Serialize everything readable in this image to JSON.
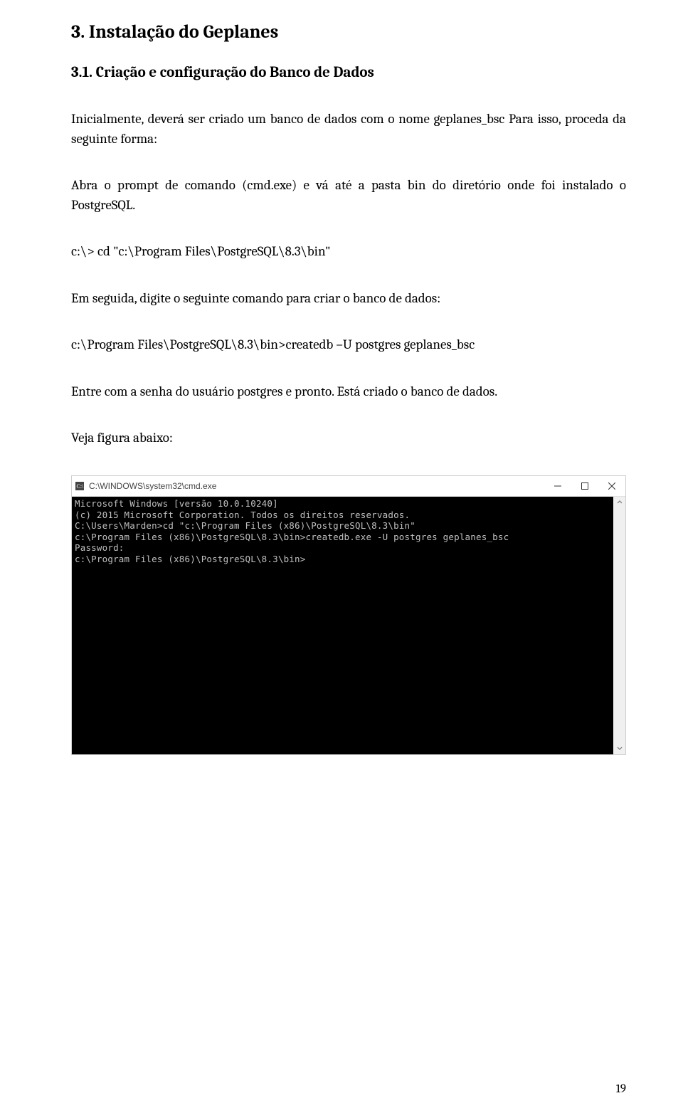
{
  "heading": "3. Instalação do Geplanes",
  "subheading": "3.1. Criação e configuração do Banco de Dados",
  "para1": "Inicialmente, deverá ser criado um banco de dados com o nome geplanes_bsc Para isso, proceda da seguinte forma:",
  "para2": "Abra o prompt de comando (cmd.exe) e vá até a pasta bin do diretório onde foi instalado o PostgreSQL.",
  "cmd1": "c:\\> cd \"c:\\Program Files\\PostgreSQL\\8.3\\bin\"",
  "para3": "Em seguida, digite o seguinte comando para criar o banco de dados:",
  "cmd2": "c:\\Program Files\\PostgreSQL\\8.3\\bin>createdb –U postgres geplanes_bsc",
  "para4": "Entre com a senha do usuário postgres e pronto. Está criado o banco de dados.",
  "para5": "Veja figura abaixo:",
  "terminal": {
    "title_icon": "cmd-icon",
    "title": "C:\\WINDOWS\\system32\\cmd.exe",
    "lines": [
      "Microsoft Windows [versão 10.0.10240]",
      "(c) 2015 Microsoft Corporation. Todos os direitos reservados.",
      "",
      "C:\\Users\\Marden>cd \"c:\\Program Files (x86)\\PostgreSQL\\8.3\\bin\"",
      "",
      "c:\\Program Files (x86)\\PostgreSQL\\8.3\\bin>createdb.exe -U postgres geplanes_bsc",
      "Password:",
      "",
      "c:\\Program Files (x86)\\PostgreSQL\\8.3\\bin>"
    ]
  },
  "page_number": "19"
}
